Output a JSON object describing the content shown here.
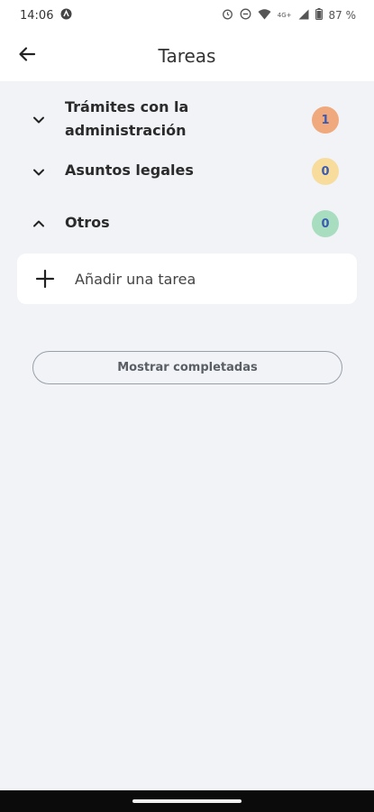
{
  "status_bar": {
    "time": "14:06",
    "battery": "87 %",
    "network": "4G+",
    "icons": [
      "app-notification-icon",
      "alarm-icon",
      "dnd-icon",
      "wifi-icon",
      "signal-icon",
      "battery-icon"
    ]
  },
  "app_bar": {
    "title": "Tareas",
    "back_icon": "arrow-left-icon"
  },
  "categories": [
    {
      "label": "Trámites con la administración",
      "count": "1",
      "expanded": false,
      "badge_bg": "#f0a97c",
      "badge_fg": "#3b5bb0"
    },
    {
      "label": "Asuntos legales",
      "count": "0",
      "expanded": false,
      "badge_bg": "#f7dc9c",
      "badge_fg": "#3b5bb0"
    },
    {
      "label": "Otros",
      "count": "0",
      "expanded": true,
      "badge_bg": "#a8ddc0",
      "badge_fg": "#3b5bb0"
    }
  ],
  "add_task": {
    "label": "Añadir una tarea",
    "icon": "plus-icon"
  },
  "show_completed": {
    "label": "Mostrar completadas"
  },
  "colors": {
    "background": "#f1f3f7",
    "card": "#ffffff"
  }
}
